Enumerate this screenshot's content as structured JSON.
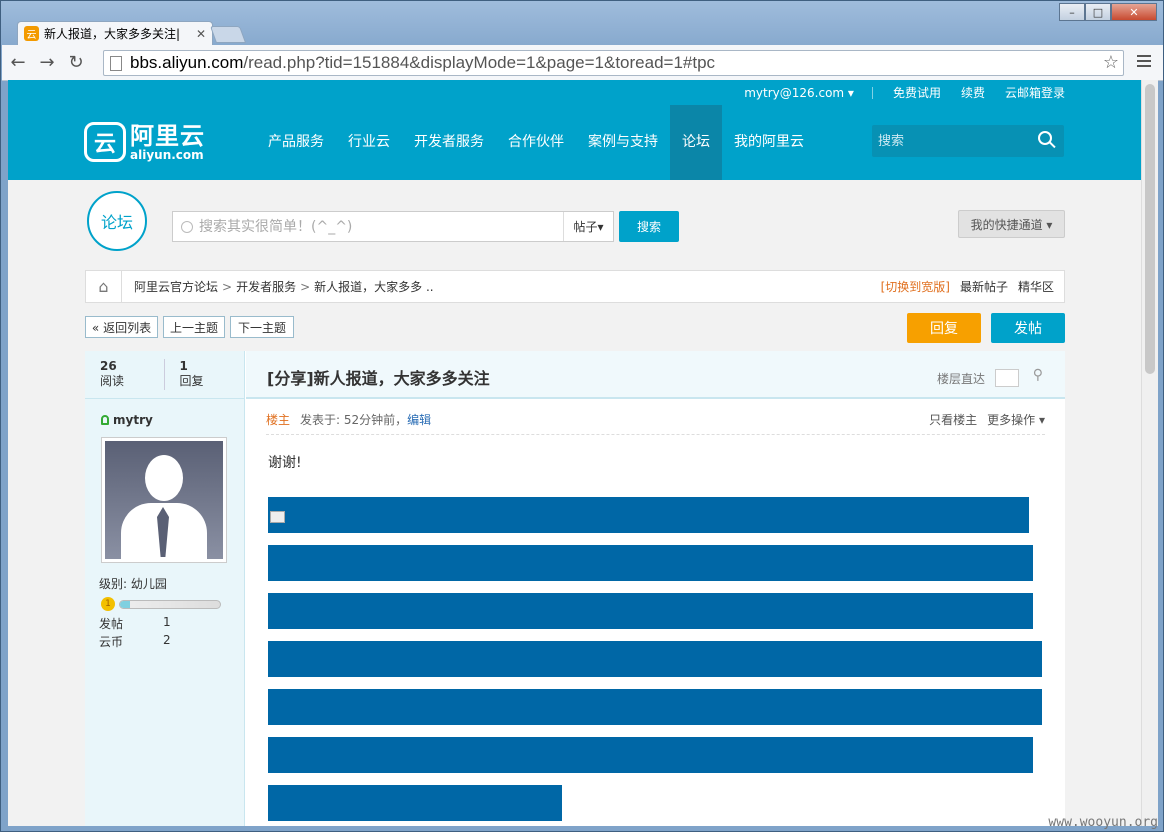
{
  "browser": {
    "tab_title": "新人报道，大家多多关注|",
    "url_host": "bbs.aliyun.com",
    "url_path": "/read.php?tid=151884&displayMode=1&page=1&toread=1#tpc"
  },
  "topbar": {
    "user": "mytry@126.com ▾",
    "trial": "免费试用",
    "renew": "续费",
    "mail_login": "云邮箱登录"
  },
  "logo": {
    "cn": "阿里云",
    "en": "aliyun.com"
  },
  "nav": [
    "产品服务",
    "行业云",
    "开发者服务",
    "合作伙伴",
    "案例与支持",
    "论坛",
    "我的阿里云"
  ],
  "header_search": {
    "placeholder": "搜索"
  },
  "forum": {
    "badge": "论坛",
    "search_placeholder": "搜索其实很简单！(^_^)",
    "search_type": "帖子▾",
    "search_button": "搜索",
    "quick_channel": "我的快捷通道 ▾"
  },
  "breadcrumb": {
    "items": [
      "阿里云官方论坛",
      "开发者服务",
      "新人报道，大家多多 .."
    ],
    "switch_wide": "[切换到宽版]",
    "latest": "最新帖子",
    "featured": "精华区"
  },
  "actions": {
    "back": "« 返回列表",
    "prev": "上一主题",
    "next": "下一主题",
    "reply": "回复",
    "post": "发帖"
  },
  "thread": {
    "views": "26",
    "views_label": "阅读",
    "replies": "1",
    "replies_label": "回复",
    "title": "[分享]新人报道，大家多多关注",
    "floor_label": "楼层直达"
  },
  "author": {
    "name": "mytry",
    "level": "级别: 幼儿园",
    "level_progress": 0.1,
    "posts_label": "发帖",
    "posts": "1",
    "coins_label": "云币",
    "coins": "2"
  },
  "post": {
    "owner": "楼主",
    "time": "发表于: 52分钟前，",
    "edit": "编辑",
    "only_owner": "只看楼主",
    "more": "更多操作 ▾",
    "text": "谢谢!"
  },
  "colors": {
    "brand": "#00a2ca",
    "reply_button": "#f7a000",
    "post_button": "#00a2ca",
    "blocks": "#0067a6"
  },
  "watermark": "www.wooyun.org"
}
